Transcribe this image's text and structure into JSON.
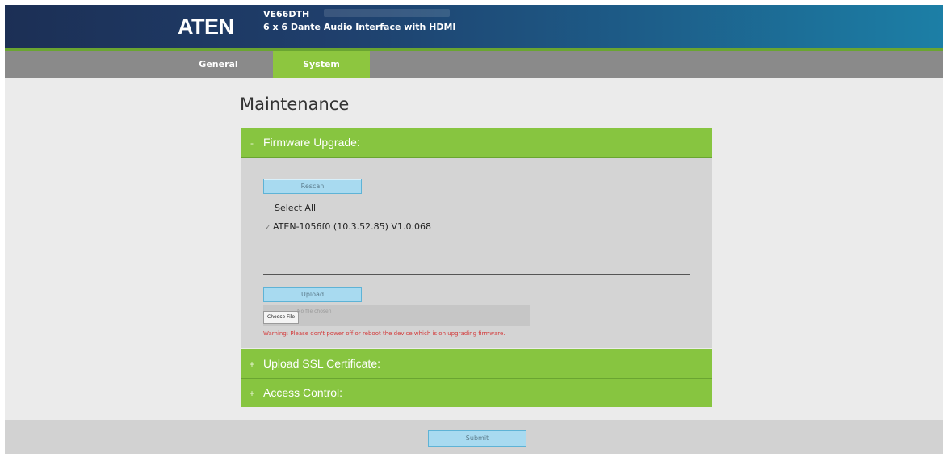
{
  "header": {
    "logo": "ATEN",
    "model": "VE66DTH",
    "description": "6 x 6 Dante Audio Interface with HDMI"
  },
  "nav": {
    "tabs": [
      {
        "label": "General",
        "active": false
      },
      {
        "label": "System",
        "active": true
      }
    ]
  },
  "page": {
    "title": "Maintenance"
  },
  "firmware": {
    "title": "Firmware Upgrade:",
    "collapse_mark": "-",
    "rescan_label": "Rescan",
    "select_all_label": "Select All",
    "devices": [
      {
        "label": "ATEN-1056f0 (10.3.52.85) V1.0.068",
        "check_mark": "✓"
      }
    ],
    "upload_label": "Upload",
    "choose_file_label": "Choose File",
    "no_file_text": "No file chosen",
    "warning": "Warning: Please don't power off or reboot the device which is on upgrading firmware."
  },
  "ssl": {
    "title": "Upload SSL Certificate:",
    "expand_mark": "+"
  },
  "access": {
    "title": "Access Control:",
    "expand_mark": "+"
  },
  "footer": {
    "submit_label": "Submit"
  },
  "colors": {
    "header_dark": "#1c2f55",
    "header_light": "#1c7fa6",
    "accent_green": "#87c540",
    "nav_gray": "#8a8a8a",
    "button_blue": "#a8daf0",
    "warning_red": "#d33a3a"
  }
}
